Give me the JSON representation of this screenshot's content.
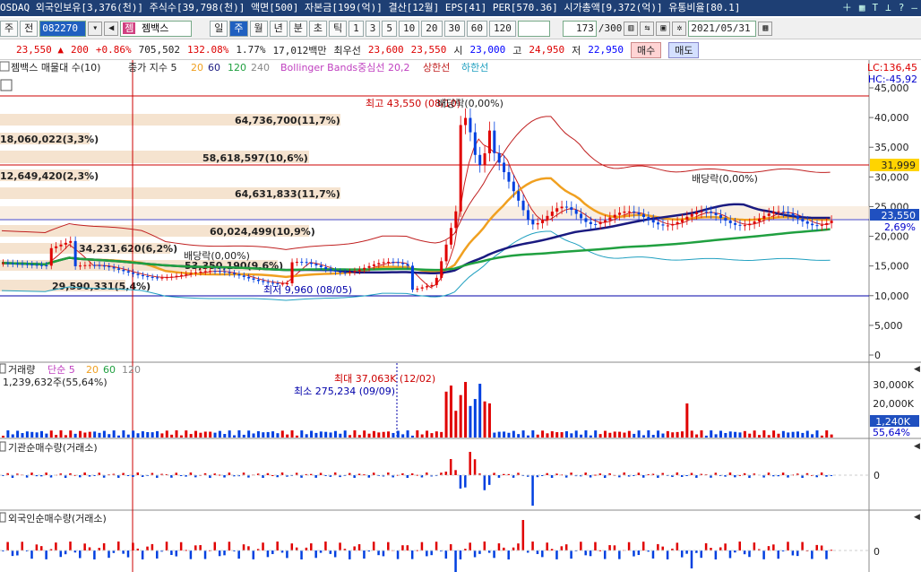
{
  "titlebar": "OSDAQ 외국인보유[3,376(천)] 주식수[39,798(천)] 액면[500] 자본금[199(억)] 결산[12월] EPS[41] PER[570.36] 시가총액[9,372(억)] 유통비율[80.1]",
  "toolbar": {
    "market": "주",
    "prev": "전",
    "code": "082270",
    "name": "젬백스",
    "periods": [
      "일",
      "주",
      "월",
      "년",
      "분",
      "초",
      "틱"
    ],
    "active_period": "주",
    "nums": [
      "1",
      "3",
      "5",
      "10",
      "20",
      "30",
      "60",
      "120"
    ],
    "count": "173",
    "count_total": "/300",
    "date": "2021/05/31"
  },
  "quote": {
    "price": "23,550",
    "arrow": "▲",
    "change": "200",
    "rate": "+0.86%",
    "volume": "705,502",
    "vol_ratio": "132.08%",
    "turnover": "1.77%",
    "amount": "17,012백만",
    "best_sell_label": "최우선",
    "best_sell": "23,600",
    "best_buy": "23,550",
    "open_label": "시",
    "open": "23,000",
    "high_label": "고",
    "high": "24,950",
    "low_label": "저",
    "low": "22,950",
    "buy_btn": "매수",
    "sell_btn": "매도"
  },
  "legend": {
    "item1": "젬백스 매물대 수(10)",
    "item2": "종가 지수 5",
    "p20": "20",
    "p60": "60",
    "p120": "120",
    "p240": "240",
    "bb": "Bollinger Bands중심선 20,2",
    "upper": "상한선",
    "lower": "하한선",
    "lc": "LC:136,45",
    "hc": "HC:-45,92"
  },
  "annotations": {
    "high": "최고 43,550 (08/10)",
    "low": "최저 9,960 (08/05)",
    "div1": "배당락(0,00%)",
    "div2": "배당락(0,00%)",
    "div3": "배당락(0,00%)",
    "price_tag": "31,999",
    "cur_tag": "23,550",
    "cur_pct": "2,69%",
    "vol_max": "최대 37,063K (12/02)",
    "vol_min": "최소 275,234 (09/09)",
    "vol_tag": "1,240K",
    "vol_pct": "55,64%"
  },
  "volume_profile": [
    "64,736,700(11,7%)",
    "18,060,022(3,3%)",
    "58,618,597(10,6%)",
    "12,649,420(2,3%)",
    "64,631,833(11,7%)",
    "60,024,499(10,9%)",
    "34,231,620(6,2%)",
    "53,350,190(9,6%)",
    "29,590,331(5,4%)"
  ],
  "price_axis": [
    "45,000",
    "40,000",
    "35,000",
    "30,000",
    "25,000",
    "20,000",
    "15,000",
    "10,000",
    "5,000",
    "0"
  ],
  "vol_panel": {
    "title": "거래량",
    "legend": "단순 5",
    "p20": "20",
    "p60": "60",
    "p120": "120",
    "value": "1,239,632주(55,64%)",
    "axis": [
      "30,000K",
      "20,000K",
      "10,000K"
    ]
  },
  "inst_panel": {
    "title": "기관순매수량(거래소)",
    "zero": "0"
  },
  "frgn_panel": {
    "title": "외국인순매수량(거래소)",
    "zero": "0"
  },
  "colors": {
    "up": "#e00000",
    "down": "#0040e0",
    "ma5": "#cc2020",
    "ma20": "#f0a020",
    "ma60": "#1a1a80",
    "ma120": "#20a040",
    "bb": "#c02020",
    "bbmid": "#c040c0",
    "lower": "#20a0c0"
  }
}
